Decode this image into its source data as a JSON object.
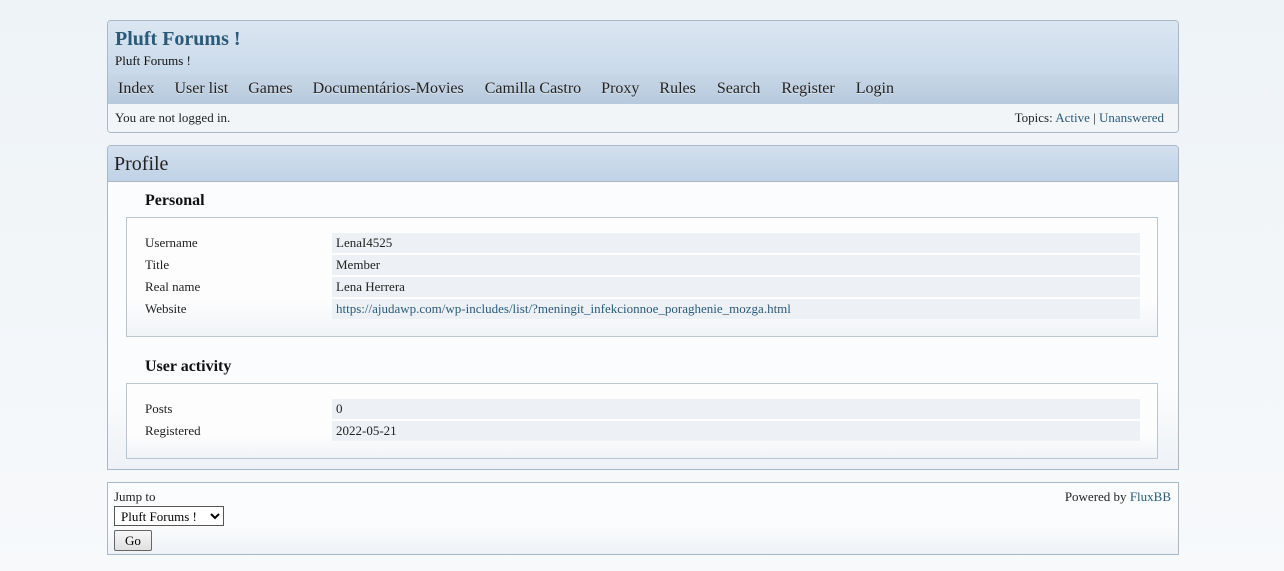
{
  "header": {
    "board_title": "Pluft Forums !",
    "board_desc": "Pluft Forums !"
  },
  "menu": {
    "items": [
      {
        "label": "Index"
      },
      {
        "label": "User list"
      },
      {
        "label": "Games"
      },
      {
        "label": "Documentários-Movies"
      },
      {
        "label": "Camilla Castro"
      },
      {
        "label": "Proxy"
      },
      {
        "label": "Rules"
      },
      {
        "label": "Search"
      },
      {
        "label": "Register"
      },
      {
        "label": "Login"
      }
    ]
  },
  "welcome": {
    "status": "You are not logged in.",
    "topics_label": "Topics:",
    "active_link": "Active",
    "separator": "|",
    "unanswered_link": "Unanswered"
  },
  "profile": {
    "title": "Profile",
    "personal": {
      "legend": "Personal",
      "rows": [
        {
          "label": "Username",
          "value": "LenaI4525"
        },
        {
          "label": "Title",
          "value": "Member"
        },
        {
          "label": "Real name",
          "value": "Lena Herrera"
        },
        {
          "label": "Website",
          "value": "https://ajudawp.com/wp-includes/list/?meningit_infekcionnoe_poraghenie_mozga.html"
        }
      ]
    },
    "activity": {
      "legend": "User activity",
      "rows": [
        {
          "label": "Posts",
          "value": "0"
        },
        {
          "label": "Registered",
          "value": "2022-05-21"
        }
      ]
    }
  },
  "footer": {
    "jump_label": "Jump to",
    "jump_selected": "Pluft Forums !",
    "go_label": "Go",
    "powered_by": "Powered by",
    "fluxbb_link": "FluxBB"
  },
  "colors": {
    "link": "#2a5a78",
    "title": "#1f4f75",
    "header_bg": "#c9d9ea",
    "menu_bg": "#b6c9dd",
    "row_bg": "#edf1f5"
  }
}
